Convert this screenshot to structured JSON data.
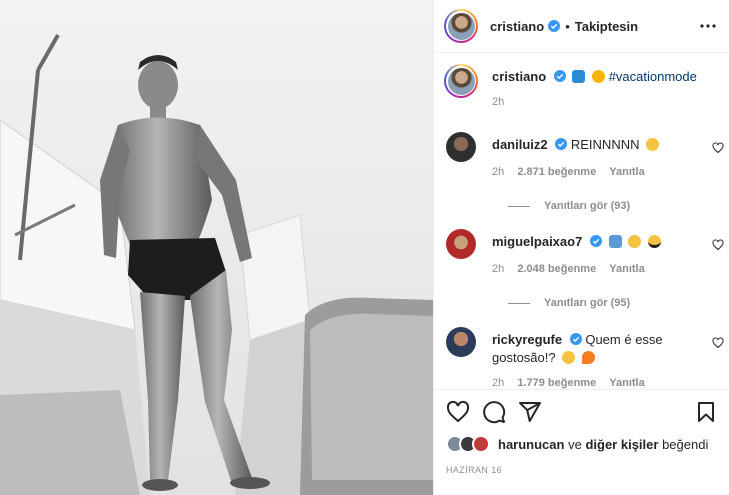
{
  "header": {
    "username": "cristiano",
    "separator": "•",
    "follow_status": "Takiptesin"
  },
  "caption": {
    "username": "cristiano",
    "emojis": [
      "wave-emoji",
      "sun-emoji"
    ],
    "hashtag": "#vacationmode",
    "time": "2h"
  },
  "comments": [
    {
      "username": "daniluiz2",
      "text": "REINNNNN",
      "emojis": [
        "heart-eyes-emoji"
      ],
      "time": "2h",
      "likes": "2.871 beğenme",
      "reply": "Yanıtla",
      "view_replies": "Yanıtları gör (93)"
    },
    {
      "username": "miguelpaixao7",
      "text": "",
      "emojis": [
        "trophy-man-emoji",
        "smile-emoji",
        "sunglasses-emoji"
      ],
      "time": "2h",
      "likes": "2.048 beğenme",
      "reply": "Yanıtla",
      "view_replies": "Yanıtları gör (95)"
    },
    {
      "username": "rickyregufe",
      "text": "Quem é esse gostosão!?",
      "emojis": [
        "laughing-emoji",
        "fire-emoji"
      ],
      "time": "2h",
      "likes": "1.779 beğenme",
      "reply": "Yanıtla"
    }
  ],
  "likes_line": {
    "user": "harunucan",
    "connector": "ve",
    "rest": "diğer kişiler",
    "suffix": "beğendi"
  },
  "date": "HAZİRAN 16",
  "colors": {
    "verified": "#3897f0",
    "hashtag": "#00376b",
    "muted": "#8e8e8e"
  }
}
